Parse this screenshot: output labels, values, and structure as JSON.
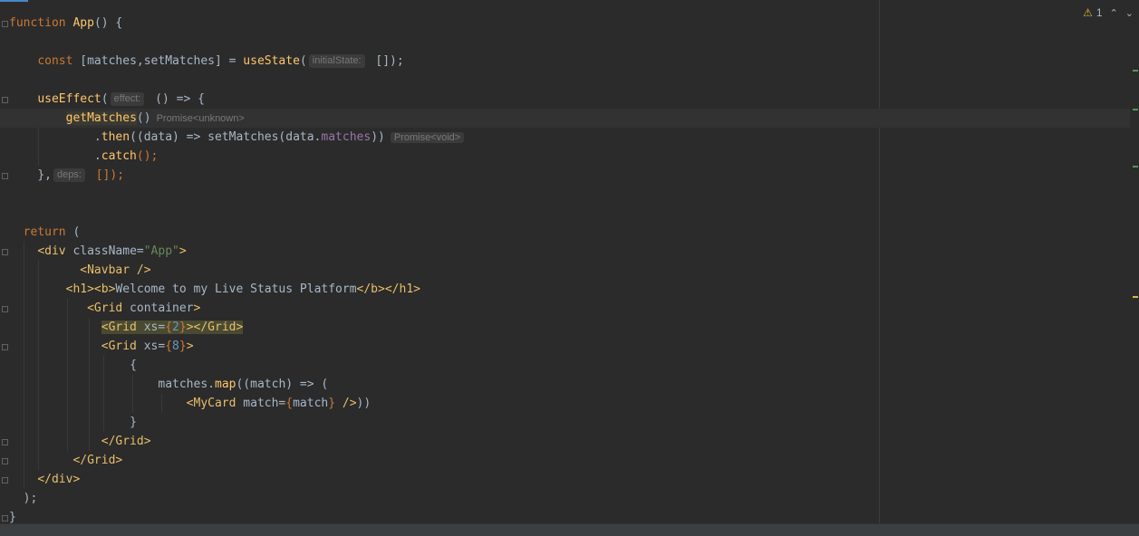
{
  "inspection": {
    "warning_count": "1",
    "warning_icon": "warning-triangle-icon"
  },
  "colors": {
    "background": "#2b2b2b",
    "keyword": "#cc7832",
    "function": "#ffc66d",
    "tag": "#e8bf6a",
    "string": "#6a8759",
    "number": "#6897bb",
    "property": "#9876aa",
    "text": "#a9b7c6"
  },
  "code": {
    "l1": {
      "kw": "function",
      "fn": "App",
      "rest": "() {"
    },
    "l3": {
      "kw": "const",
      "a": " [matches,setMatches] = ",
      "fn": "useState",
      "p": "(",
      "hint": "initialState:",
      "rest": " []);"
    },
    "l5": {
      "fn": "useEffect",
      "p": "(",
      "hint": "effect:",
      "rest": " () => {"
    },
    "l6": {
      "fn": "getMatches",
      "p": "()",
      "type": "Promise<unknown>"
    },
    "l7": {
      "a": ".",
      "fn": "then",
      "b": "((data) => setMatches(data.",
      "prop": "matches",
      "c": "))",
      "type": "Promise<void>"
    },
    "l8": {
      "a": ".",
      "fn": "catch",
      "b": "();"
    },
    "l9": {
      "a": "},",
      "hint": "deps:",
      "b": " []);"
    },
    "l12": {
      "kw": "return",
      "rest": " ("
    },
    "l13": {
      "t1": "<div",
      "attr": " className=",
      "str": "\"App\"",
      "t2": ">"
    },
    "l14": {
      "t": "<Navbar />"
    },
    "l15": {
      "t1": "<h1><b>",
      "text": "Welcome to my Live Status Platform",
      "t2": "</b></h1>"
    },
    "l16": {
      "t1": "<Grid",
      "attr": " container",
      "t2": ">"
    },
    "l17": {
      "t1": "<Grid",
      "attr": " xs=",
      "b1": "{",
      "num": "2",
      "b2": "}",
      "t2": "></Grid>"
    },
    "l18": {
      "t1": "<Grid",
      "attr": " xs=",
      "b1": "{",
      "num": "8",
      "b2": "}",
      "t2": ">"
    },
    "l19": {
      "a": "{"
    },
    "l20": {
      "a": "matches.",
      "fn": "map",
      "b": "((match) => ("
    },
    "l21": {
      "t1": "<MyCard",
      "attr": " match=",
      "b1": "{",
      "v": "match",
      "b2": "}",
      "t2": " />",
      "c": "))"
    },
    "l22": {
      "a": "}"
    },
    "l23": {
      "t": "</Grid>"
    },
    "l24": {
      "t": "</Grid>"
    },
    "l25": {
      "t": "</div>"
    },
    "l26": {
      "a": ");"
    },
    "l27": {
      "a": "}"
    }
  }
}
